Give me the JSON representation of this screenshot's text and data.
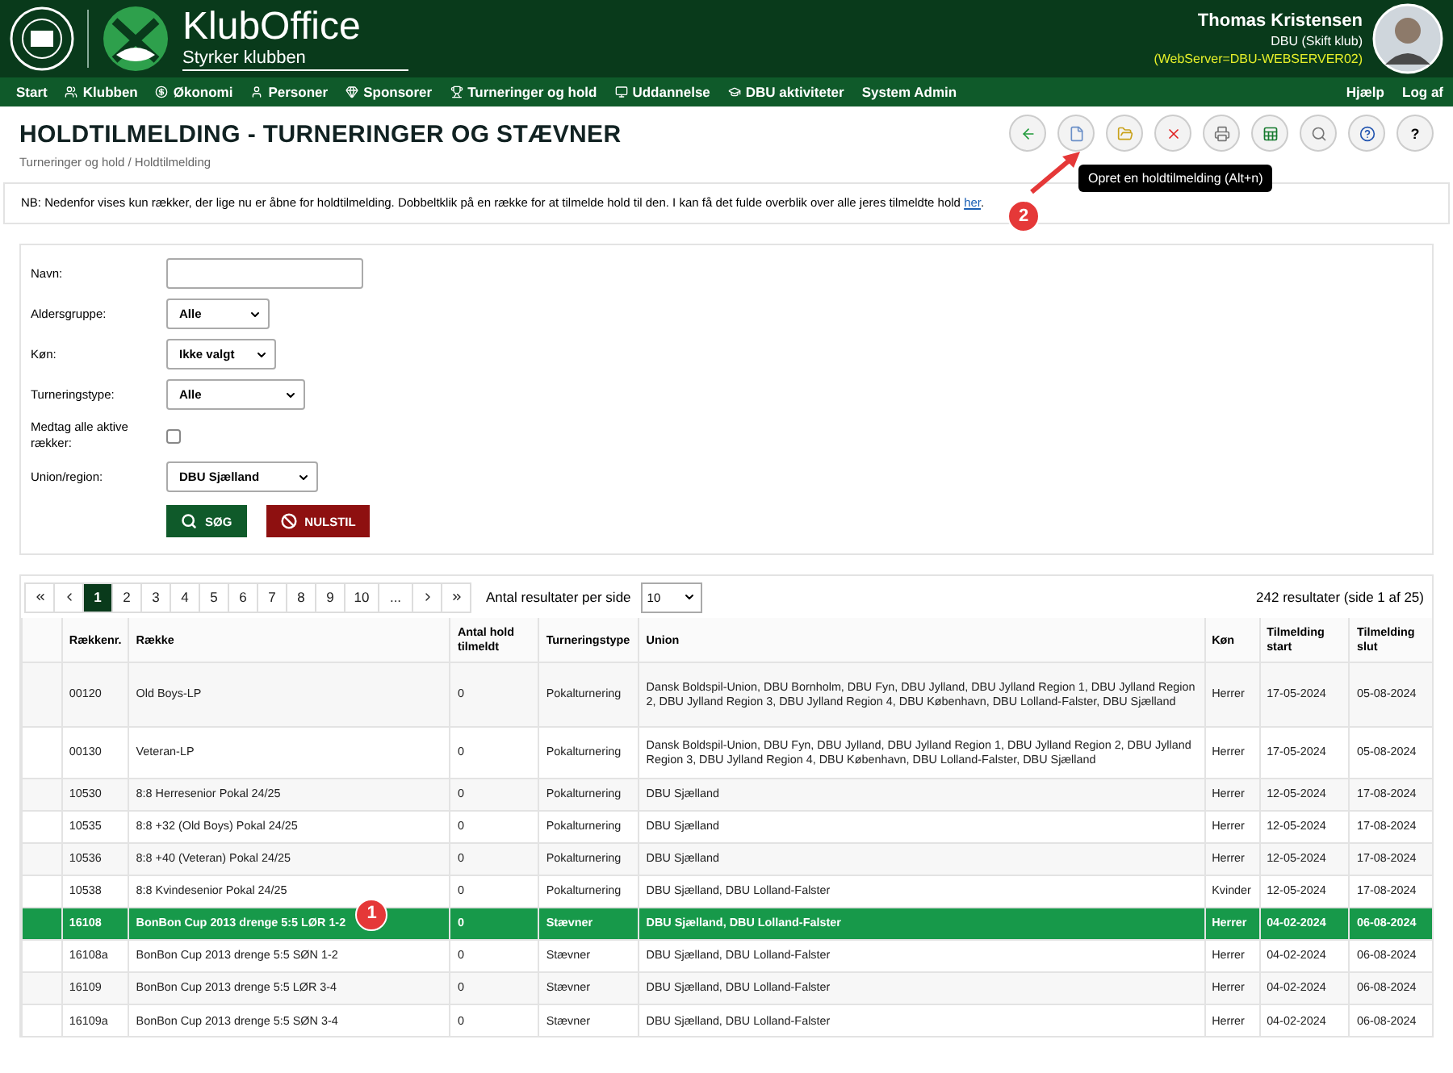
{
  "header": {
    "brand": "KlubOffice",
    "tagline": "Styrker klubben",
    "user": {
      "name": "Thomas Kristensen",
      "club": "DBU (Skift klub)",
      "server": "(WebServer=DBU-WEBSERVER02)"
    }
  },
  "nav": [
    "Start",
    "Klubben",
    "Økonomi",
    "Personer",
    "Sponsorer",
    "Turneringer og hold",
    "Uddannelse",
    "DBU aktiviteter",
    "System Admin"
  ],
  "nav_right": [
    "Hjælp",
    "Log af"
  ],
  "title": "HOLDTILMELDING - TURNERINGER OG STÆVNER",
  "breadcrumb": "Turneringer og hold / Holdtilmelding",
  "tooltip": "Opret en holdtilmelding (Alt+n)",
  "annotations": [
    "1",
    "2"
  ],
  "help_symbol": "?",
  "notice": {
    "tail": ".",
    "text": "NB: Nedenfor vises kun rækker, der lige nu er åbne for holdtilmelding. Dobbeltklik på en række for at tilmelde hold til den. I kan få det fulde overblik over alle jeres tilmeldte hold",
    "link": "her"
  },
  "filters": [
    {
      "kind": "text",
      "label": "Navn:"
    },
    {
      "kind": "select",
      "label": "Aldersgruppe:",
      "value": "Alle"
    },
    {
      "kind": "select",
      "label": "Køn:",
      "value": "Ikke valgt"
    },
    {
      "kind": "select",
      "label": "Turneringstype:",
      "value": "Alle"
    },
    {
      "kind": "checkbox",
      "label": "Medtag alle aktive rækker:",
      "checked": false
    },
    {
      "kind": "select",
      "label": "Union/region:",
      "value": "DBU Sjælland"
    }
  ],
  "buttons": [
    "SØG",
    "NULSTIL"
  ],
  "pagination": {
    "pages": [
      {
        "label": "1",
        "selected": true
      },
      {
        "label": "2",
        "selected": false
      },
      {
        "label": "3",
        "selected": false
      },
      {
        "label": "4",
        "selected": false
      },
      {
        "label": "5",
        "selected": false
      },
      {
        "label": "6",
        "selected": false
      },
      {
        "label": "7",
        "selected": false
      },
      {
        "label": "8",
        "selected": false
      },
      {
        "label": "9",
        "selected": false
      },
      {
        "label": "10",
        "selected": false
      },
      {
        "label": "...",
        "selected": false
      }
    ],
    "per_page_label": "Antal resultater per side",
    "per_page": "10",
    "results": "242 resultater (side 1 af 25)"
  },
  "table": {
    "columns": [
      "Rækkenr.",
      "Række",
      "Antal hold tilmeldt",
      "Turneringstype",
      "Union",
      "Køn",
      "Tilmelding start",
      "Tilmelding slut"
    ],
    "rows": [
      {
        "selected": false,
        "cells": [
          "00120",
          "Old Boys-LP",
          "0",
          "Pokalturnering",
          "Dansk Boldspil-Union, DBU Bornholm, DBU Fyn, DBU Jylland, DBU Jylland Region 1, DBU Jylland Region 2, DBU Jylland Region 3, DBU Jylland Region 4, DBU København, DBU Lolland-Falster, DBU Sjælland",
          "Herrer",
          "17-05-2024",
          "05-08-2024"
        ]
      },
      {
        "selected": false,
        "cells": [
          "00130",
          "Veteran-LP",
          "0",
          "Pokalturnering",
          "Dansk Boldspil-Union, DBU Fyn, DBU Jylland, DBU Jylland Region 1, DBU Jylland Region 2, DBU Jylland Region 3, DBU Jylland Region 4, DBU København, DBU Lolland-Falster, DBU Sjælland",
          "Herrer",
          "17-05-2024",
          "05-08-2024"
        ]
      },
      {
        "selected": false,
        "cells": [
          "10530",
          "8:8 Herresenior Pokal 24/25",
          "0",
          "Pokalturnering",
          "DBU Sjælland",
          "Herrer",
          "12-05-2024",
          "17-08-2024"
        ]
      },
      {
        "selected": false,
        "cells": [
          "10535",
          "8:8 +32 (Old Boys) Pokal 24/25",
          "0",
          "Pokalturnering",
          "DBU Sjælland",
          "Herrer",
          "12-05-2024",
          "17-08-2024"
        ]
      },
      {
        "selected": false,
        "cells": [
          "10536",
          "8:8 +40 (Veteran) Pokal 24/25",
          "0",
          "Pokalturnering",
          "DBU Sjælland",
          "Herrer",
          "12-05-2024",
          "17-08-2024"
        ]
      },
      {
        "selected": false,
        "cells": [
          "10538",
          "8:8 Kvindesenior Pokal 24/25",
          "0",
          "Pokalturnering",
          "DBU Sjælland, DBU Lolland-Falster",
          "Kvinder",
          "12-05-2024",
          "17-08-2024"
        ]
      },
      {
        "selected": true,
        "cells": [
          "16108",
          "BonBon Cup 2013 drenge 5:5 LØR 1-2",
          "0",
          "Stævner",
          "DBU Sjælland, DBU Lolland-Falster",
          "Herrer",
          "04-02-2024",
          "06-08-2024"
        ]
      },
      {
        "selected": false,
        "cells": [
          "16108a",
          "BonBon Cup 2013 drenge 5:5 SØN 1-2",
          "0",
          "Stævner",
          "DBU Sjælland, DBU Lolland-Falster",
          "Herrer",
          "04-02-2024",
          "06-08-2024"
        ]
      },
      {
        "selected": false,
        "cells": [
          "16109",
          "BonBon Cup 2013 drenge 5:5 LØR 3-4",
          "0",
          "Stævner",
          "DBU Sjælland, DBU Lolland-Falster",
          "Herrer",
          "04-02-2024",
          "06-08-2024"
        ]
      },
      {
        "selected": false,
        "cells": [
          "16109a",
          "BonBon Cup 2013 drenge 5:5 SØN 3-4",
          "0",
          "Stævner",
          "DBU Sjælland, DBU Lolland-Falster",
          "Herrer",
          "04-02-2024",
          "06-08-2024"
        ]
      }
    ]
  }
}
